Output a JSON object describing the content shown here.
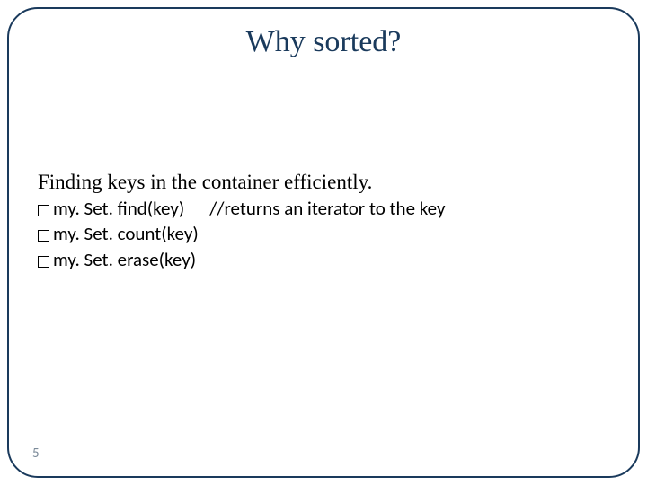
{
  "slide": {
    "title": "Why sorted?",
    "lead": "Finding keys in the container efficiently.",
    "items": [
      {
        "api": "my. Set. find(key)",
        "comment": "//returns an iterator to the key"
      },
      {
        "api": "my. Set. count(key)",
        "comment": ""
      },
      {
        "api": "my. Set. erase(key)",
        "comment": ""
      }
    ],
    "page_number": "5"
  }
}
